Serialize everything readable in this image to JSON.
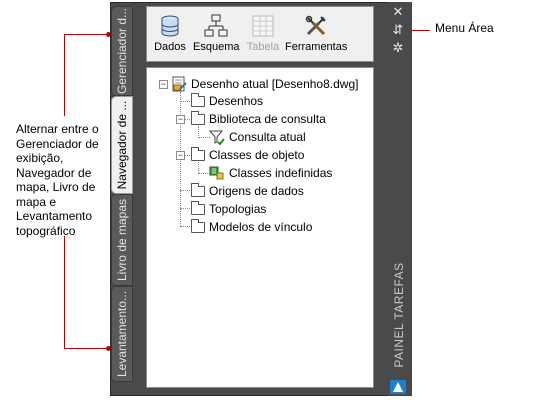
{
  "annotations": {
    "left_callout": [
      "Alternar entre o",
      "Gerenciador de",
      "exibição,",
      "Navegador de",
      "mapa, Livro de",
      "mapa e",
      "Levantamento",
      "topográfico"
    ],
    "right_callout": "Menu Área",
    "line_color": "#c00000"
  },
  "tabs": [
    {
      "label": "Gerenciador d...",
      "active": false
    },
    {
      "label": "Navegador de ...",
      "active": true
    },
    {
      "label": "Livro de mapas",
      "active": false
    },
    {
      "label": "Levantamento...",
      "active": false
    }
  ],
  "toolbar": {
    "items": [
      {
        "label": "Dados",
        "icon": "database-icon",
        "enabled": true
      },
      {
        "label": "Esquema",
        "icon": "schema-icon",
        "enabled": true
      },
      {
        "label": "Tabela",
        "icon": "table-icon",
        "enabled": false
      },
      {
        "label": "Ferramentas",
        "icon": "tools-icon",
        "enabled": true
      }
    ]
  },
  "tree": {
    "root": "Desenho atual [Desenho8.dwg]",
    "items": [
      {
        "label": "Desenhos"
      },
      {
        "label": "Biblioteca de consulta"
      },
      {
        "label": "Consulta atual"
      },
      {
        "label": "Classes de objeto"
      },
      {
        "label": "Classes indefinidas"
      },
      {
        "label": "Origens de dados"
      },
      {
        "label": "Topologias"
      },
      {
        "label": "Modelos de vínculo"
      }
    ]
  },
  "side_panel": {
    "title": "PAINEL TAREFAS",
    "close_symbol": "✕",
    "menu_symbol": "⇵",
    "settings_symbol": "✲"
  },
  "colors": {
    "palette_bg": "#4a4a4a",
    "accent_blue": "#1e7fd0"
  }
}
